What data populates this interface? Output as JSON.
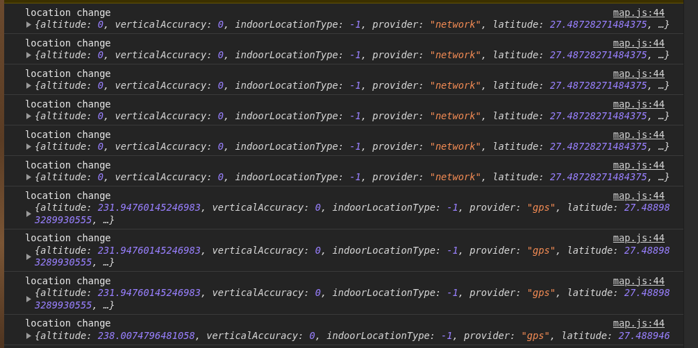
{
  "entries": [
    {
      "message": "location change",
      "source": "map.js:44",
      "preview_lines": [
        [
          {
            "kind": "plain",
            "text": "{altitude: "
          },
          {
            "kind": "number",
            "text": "0"
          },
          {
            "kind": "plain",
            "text": ", verticalAccuracy: "
          },
          {
            "kind": "number",
            "text": "0"
          },
          {
            "kind": "plain",
            "text": ", indoorLocationType: "
          },
          {
            "kind": "number",
            "text": "-1"
          },
          {
            "kind": "plain",
            "text": ", provider: "
          },
          {
            "kind": "string",
            "text": "\"network\""
          },
          {
            "kind": "plain",
            "text": ", latitude: "
          },
          {
            "kind": "number",
            "text": "27.48728271484375"
          },
          {
            "kind": "plain",
            "text": ", …}"
          }
        ]
      ]
    },
    {
      "message": "location change",
      "source": "map.js:44",
      "preview_lines": [
        [
          {
            "kind": "plain",
            "text": "{altitude: "
          },
          {
            "kind": "number",
            "text": "0"
          },
          {
            "kind": "plain",
            "text": ", verticalAccuracy: "
          },
          {
            "kind": "number",
            "text": "0"
          },
          {
            "kind": "plain",
            "text": ", indoorLocationType: "
          },
          {
            "kind": "number",
            "text": "-1"
          },
          {
            "kind": "plain",
            "text": ", provider: "
          },
          {
            "kind": "string",
            "text": "\"network\""
          },
          {
            "kind": "plain",
            "text": ", latitude: "
          },
          {
            "kind": "number",
            "text": "27.48728271484375"
          },
          {
            "kind": "plain",
            "text": ", …}"
          }
        ]
      ]
    },
    {
      "message": "location change",
      "source": "map.js:44",
      "preview_lines": [
        [
          {
            "kind": "plain",
            "text": "{altitude: "
          },
          {
            "kind": "number",
            "text": "0"
          },
          {
            "kind": "plain",
            "text": ", verticalAccuracy: "
          },
          {
            "kind": "number",
            "text": "0"
          },
          {
            "kind": "plain",
            "text": ", indoorLocationType: "
          },
          {
            "kind": "number",
            "text": "-1"
          },
          {
            "kind": "plain",
            "text": ", provider: "
          },
          {
            "kind": "string",
            "text": "\"network\""
          },
          {
            "kind": "plain",
            "text": ", latitude: "
          },
          {
            "kind": "number",
            "text": "27.48728271484375"
          },
          {
            "kind": "plain",
            "text": ", …}"
          }
        ]
      ]
    },
    {
      "message": "location change",
      "source": "map.js:44",
      "preview_lines": [
        [
          {
            "kind": "plain",
            "text": "{altitude: "
          },
          {
            "kind": "number",
            "text": "0"
          },
          {
            "kind": "plain",
            "text": ", verticalAccuracy: "
          },
          {
            "kind": "number",
            "text": "0"
          },
          {
            "kind": "plain",
            "text": ", indoorLocationType: "
          },
          {
            "kind": "number",
            "text": "-1"
          },
          {
            "kind": "plain",
            "text": ", provider: "
          },
          {
            "kind": "string",
            "text": "\"network\""
          },
          {
            "kind": "plain",
            "text": ", latitude: "
          },
          {
            "kind": "number",
            "text": "27.48728271484375"
          },
          {
            "kind": "plain",
            "text": ", …}"
          }
        ]
      ]
    },
    {
      "message": "location change",
      "source": "map.js:44",
      "preview_lines": [
        [
          {
            "kind": "plain",
            "text": "{altitude: "
          },
          {
            "kind": "number",
            "text": "0"
          },
          {
            "kind": "plain",
            "text": ", verticalAccuracy: "
          },
          {
            "kind": "number",
            "text": "0"
          },
          {
            "kind": "plain",
            "text": ", indoorLocationType: "
          },
          {
            "kind": "number",
            "text": "-1"
          },
          {
            "kind": "plain",
            "text": ", provider: "
          },
          {
            "kind": "string",
            "text": "\"network\""
          },
          {
            "kind": "plain",
            "text": ", latitude: "
          },
          {
            "kind": "number",
            "text": "27.48728271484375"
          },
          {
            "kind": "plain",
            "text": ", …}"
          }
        ]
      ]
    },
    {
      "message": "location change",
      "source": "map.js:44",
      "preview_lines": [
        [
          {
            "kind": "plain",
            "text": "{altitude: "
          },
          {
            "kind": "number",
            "text": "0"
          },
          {
            "kind": "plain",
            "text": ", verticalAccuracy: "
          },
          {
            "kind": "number",
            "text": "0"
          },
          {
            "kind": "plain",
            "text": ", indoorLocationType: "
          },
          {
            "kind": "number",
            "text": "-1"
          },
          {
            "kind": "plain",
            "text": ", provider: "
          },
          {
            "kind": "string",
            "text": "\"network\""
          },
          {
            "kind": "plain",
            "text": ", latitude: "
          },
          {
            "kind": "number",
            "text": "27.48728271484375"
          },
          {
            "kind": "plain",
            "text": ", …}"
          }
        ]
      ]
    },
    {
      "message": "location change",
      "source": "map.js:44",
      "preview_lines": [
        [
          {
            "kind": "plain",
            "text": "{altitude: "
          },
          {
            "kind": "number",
            "text": "231.94760145246983"
          },
          {
            "kind": "plain",
            "text": ", verticalAccuracy: "
          },
          {
            "kind": "number",
            "text": "0"
          },
          {
            "kind": "plain",
            "text": ", indoorLocationType: "
          },
          {
            "kind": "number",
            "text": "-1"
          },
          {
            "kind": "plain",
            "text": ", provider: "
          },
          {
            "kind": "string",
            "text": "\"gps\""
          },
          {
            "kind": "plain",
            "text": ", latitude: "
          },
          {
            "kind": "number",
            "text": "27.48898"
          }
        ],
        [
          {
            "kind": "number",
            "text": "3289930555"
          },
          {
            "kind": "plain",
            "text": ", …}"
          }
        ]
      ]
    },
    {
      "message": "location change",
      "source": "map.js:44",
      "preview_lines": [
        [
          {
            "kind": "plain",
            "text": "{altitude: "
          },
          {
            "kind": "number",
            "text": "231.94760145246983"
          },
          {
            "kind": "plain",
            "text": ", verticalAccuracy: "
          },
          {
            "kind": "number",
            "text": "0"
          },
          {
            "kind": "plain",
            "text": ", indoorLocationType: "
          },
          {
            "kind": "number",
            "text": "-1"
          },
          {
            "kind": "plain",
            "text": ", provider: "
          },
          {
            "kind": "string",
            "text": "\"gps\""
          },
          {
            "kind": "plain",
            "text": ", latitude: "
          },
          {
            "kind": "number",
            "text": "27.48898"
          }
        ],
        [
          {
            "kind": "number",
            "text": "3289930555"
          },
          {
            "kind": "plain",
            "text": ", …}"
          }
        ]
      ]
    },
    {
      "message": "location change",
      "source": "map.js:44",
      "preview_lines": [
        [
          {
            "kind": "plain",
            "text": "{altitude: "
          },
          {
            "kind": "number",
            "text": "231.94760145246983"
          },
          {
            "kind": "plain",
            "text": ", verticalAccuracy: "
          },
          {
            "kind": "number",
            "text": "0"
          },
          {
            "kind": "plain",
            "text": ", indoorLocationType: "
          },
          {
            "kind": "number",
            "text": "-1"
          },
          {
            "kind": "plain",
            "text": ", provider: "
          },
          {
            "kind": "string",
            "text": "\"gps\""
          },
          {
            "kind": "plain",
            "text": ", latitude: "
          },
          {
            "kind": "number",
            "text": "27.48898"
          }
        ],
        [
          {
            "kind": "number",
            "text": "3289930555"
          },
          {
            "kind": "plain",
            "text": ", …}"
          }
        ]
      ]
    },
    {
      "message": "location change",
      "source": "map.js:44",
      "preview_lines": [
        [
          {
            "kind": "plain",
            "text": "{altitude: "
          },
          {
            "kind": "number",
            "text": "238.0074796481058"
          },
          {
            "kind": "plain",
            "text": ", verticalAccuracy: "
          },
          {
            "kind": "number",
            "text": "0"
          },
          {
            "kind": "plain",
            "text": ", indoorLocationType: "
          },
          {
            "kind": "number",
            "text": "-1"
          },
          {
            "kind": "plain",
            "text": ", provider: "
          },
          {
            "kind": "string",
            "text": "\"gps\""
          },
          {
            "kind": "plain",
            "text": ", latitude: "
          },
          {
            "kind": "number",
            "text": "27.488946"
          }
        ]
      ]
    }
  ]
}
